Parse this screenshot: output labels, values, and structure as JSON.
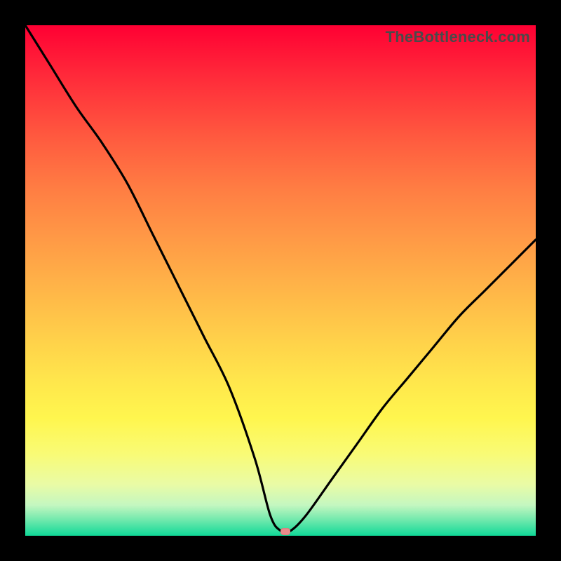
{
  "watermark": "TheBottleneck.com",
  "chart_data": {
    "type": "line",
    "title": "",
    "xlabel": "",
    "ylabel": "",
    "xlim": [
      0,
      100
    ],
    "ylim": [
      0,
      100
    ],
    "x": [
      0,
      5,
      10,
      15,
      20,
      25,
      30,
      35,
      40,
      45,
      48,
      50,
      52,
      55,
      60,
      65,
      70,
      75,
      80,
      85,
      90,
      95,
      100
    ],
    "values": [
      100,
      92,
      84,
      77,
      69,
      59,
      49,
      39,
      29,
      15,
      4,
      1,
      1,
      4,
      11,
      18,
      25,
      31,
      37,
      43,
      48,
      53,
      58
    ],
    "gradient_stops": [
      {
        "pos": 0,
        "color": "#ff0033"
      },
      {
        "pos": 50,
        "color": "#ffcc33"
      },
      {
        "pos": 80,
        "color": "#ffff55"
      },
      {
        "pos": 100,
        "color": "#10d998"
      }
    ],
    "marker": {
      "x": 51,
      "y": 0.8,
      "color": "#e98b8b"
    }
  }
}
